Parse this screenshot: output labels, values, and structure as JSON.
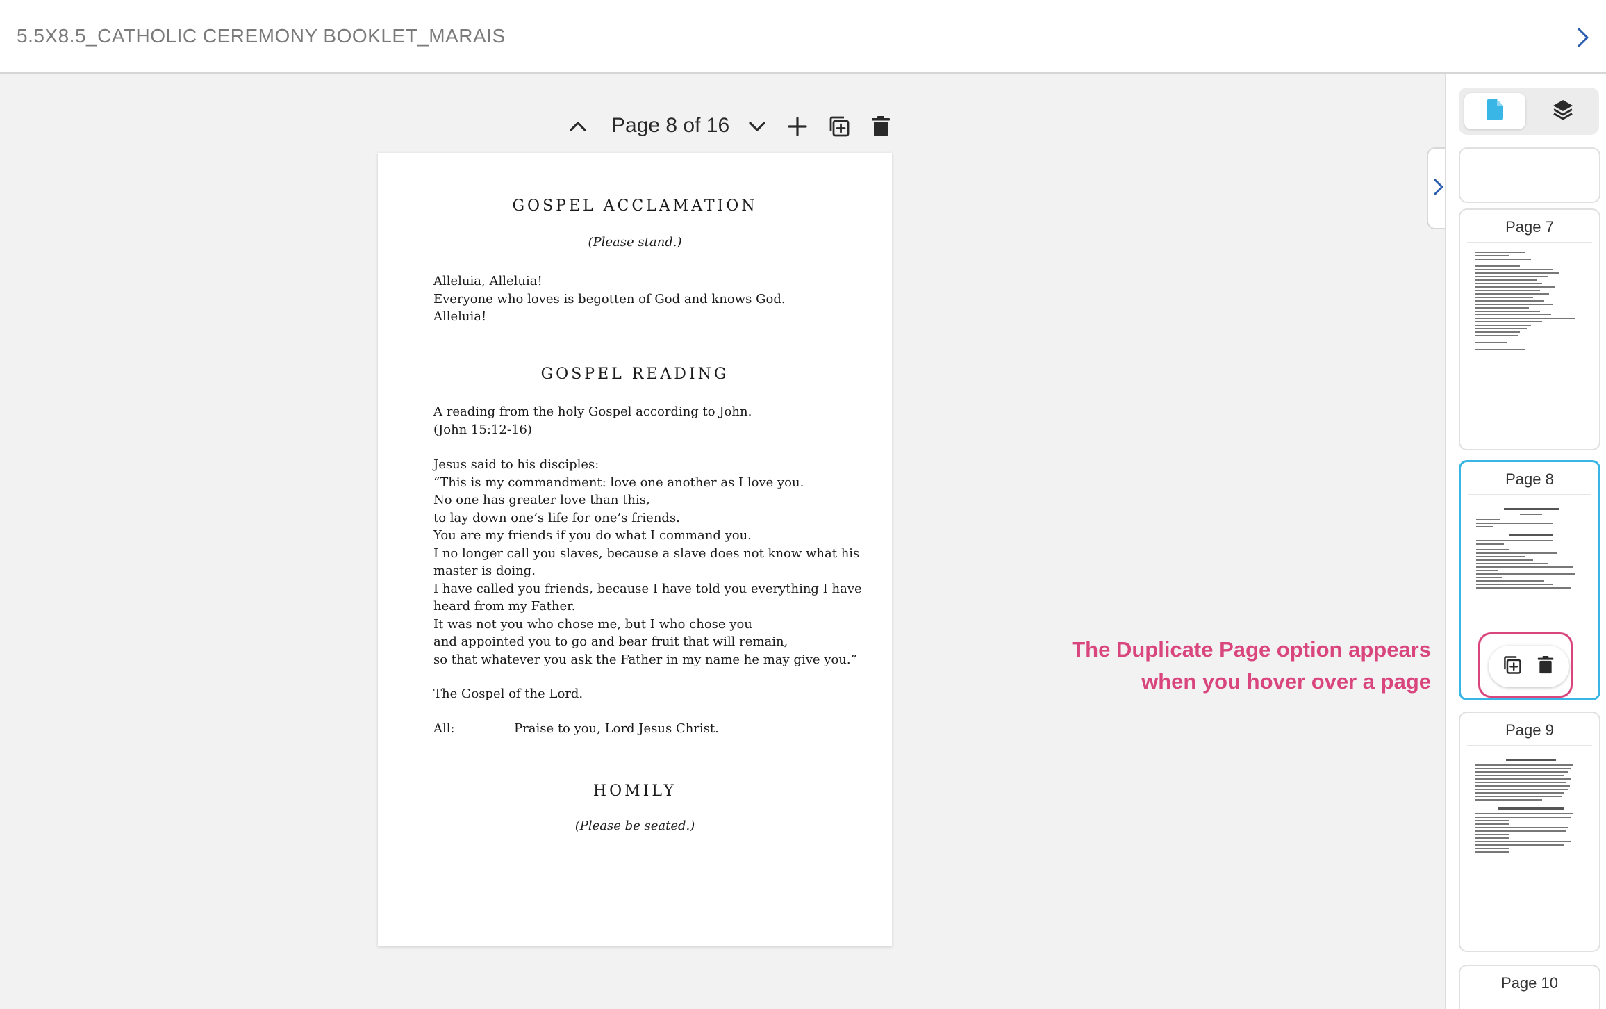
{
  "header": {
    "title": "5.5X8.5_CATHOLIC CEREMONY BOOKLET_MARAIS"
  },
  "toolbar": {
    "page_indicator": "Page 8 of 16"
  },
  "page": {
    "gospel_acclamation": {
      "heading": "GOSPEL ACCLAMATION",
      "instruction": "(Please stand.)",
      "lines": [
        "Alleluia, Alleluia!",
        "Everyone who loves is begotten of God and knows God.",
        "Alleluia!"
      ]
    },
    "gospel_reading": {
      "heading": "GOSPEL READING",
      "intro_lines": [
        "A reading from the holy Gospel according to John.",
        "(John 15:12-16)"
      ],
      "body_lines": [
        "Jesus said to his disciples:",
        "“This is my commandment: love one another as I love you.",
        "No one has greater love than this,",
        "to lay down one’s life for one’s friends.",
        "You are my friends if you do what I command you.",
        "I no longer call you slaves, because a slave does not know what his",
        "master is doing.",
        "I have called you friends, because I have told you everything I have",
        "heard from my Father.",
        "It was not you who chose me, but I who chose you",
        "and appointed you to go and bear fruit that will remain,",
        "so that whatever you ask the Father in my name he may give you.”"
      ],
      "closing": "The Gospel of the Lord.",
      "response_label": "All:",
      "response_text": "Praise to you, Lord Jesus Christ."
    },
    "homily": {
      "heading": "HOMILY",
      "instruction": "(Please be seated.)"
    }
  },
  "sidebar": {
    "thumbnails": [
      {
        "label": "Page 7"
      },
      {
        "label": "Page 8"
      },
      {
        "label": "Page 9"
      },
      {
        "label": "Page 10"
      }
    ]
  },
  "annotation": {
    "line1": "The Duplicate Page option appears",
    "line2": "when you hover over a page"
  },
  "colors": {
    "accent": "#39b6e6",
    "annotation": "#d9467e",
    "nav_blue": "#2a5db0"
  }
}
